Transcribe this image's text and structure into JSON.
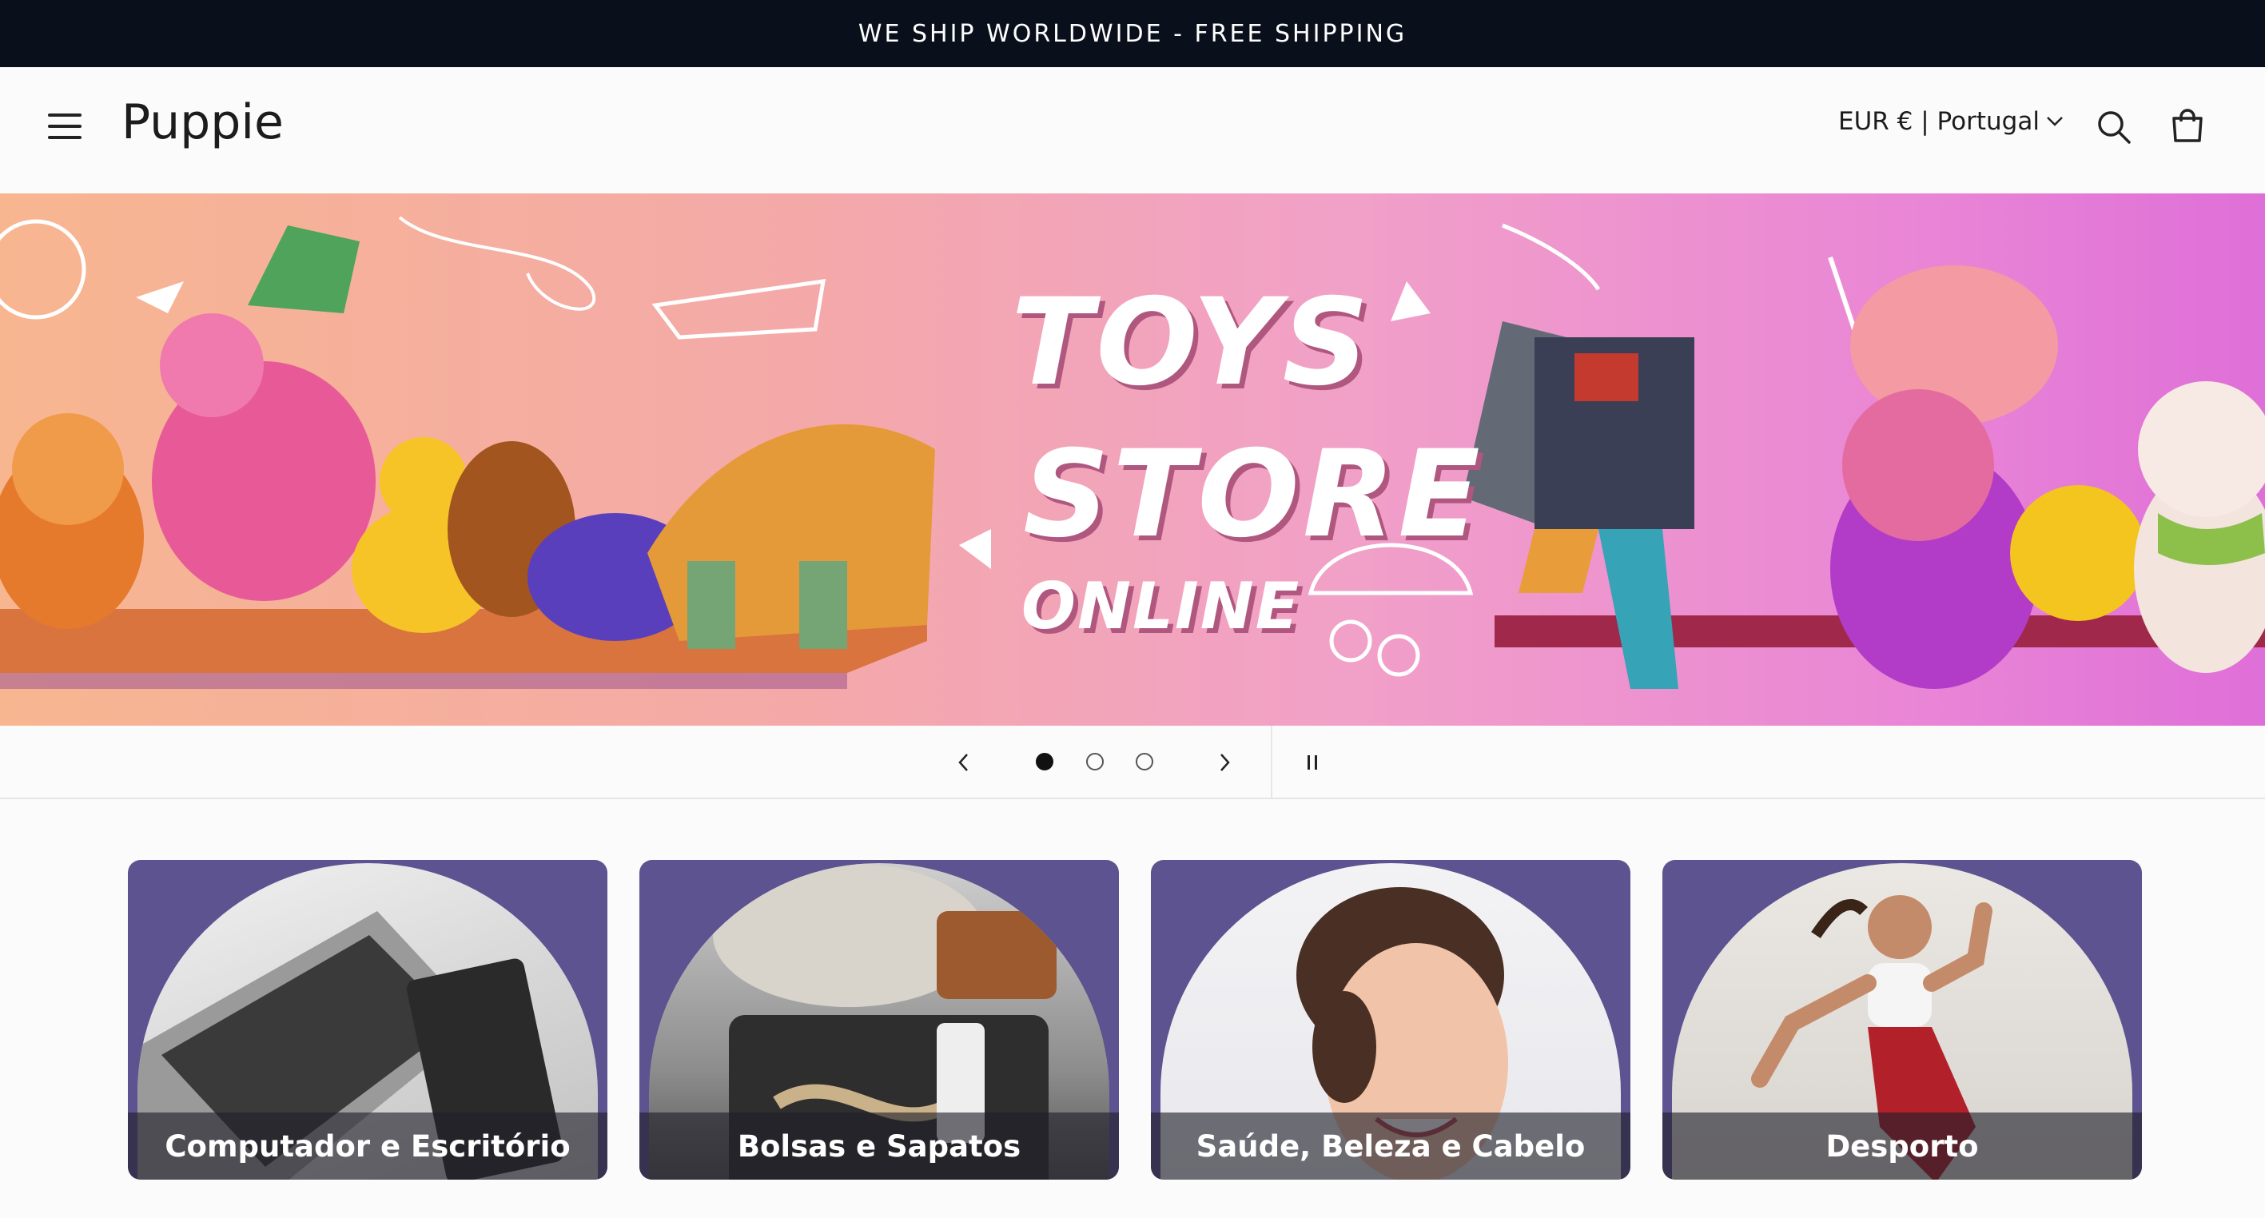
{
  "announcement": {
    "text": "WE SHIP WORLDWIDE - FREE SHIPPING"
  },
  "header": {
    "logo": "Puppie",
    "currency": "EUR € | Portugal"
  },
  "hero": {
    "line1": "TOYS",
    "line2": "STORE",
    "line3": "ONLINE",
    "slide_count": 3,
    "active_slide": 1
  },
  "categories": [
    {
      "label": "Computador e Escritório"
    },
    {
      "label": "Bolsas e Sapatos"
    },
    {
      "label": "Saúde, Beleza e Cabelo"
    },
    {
      "label": "Desporto"
    }
  ],
  "colors": {
    "announcement_bg": "#0a0f1c",
    "card_bg": "#5c5390",
    "hero_gradient_start": "#f7b690",
    "hero_gradient_end": "#df6fd8"
  },
  "icons": [
    "menu-icon",
    "search-icon",
    "cart-icon",
    "chevron-down-icon",
    "chevron-left-icon",
    "chevron-right-icon",
    "pause-icon"
  ]
}
